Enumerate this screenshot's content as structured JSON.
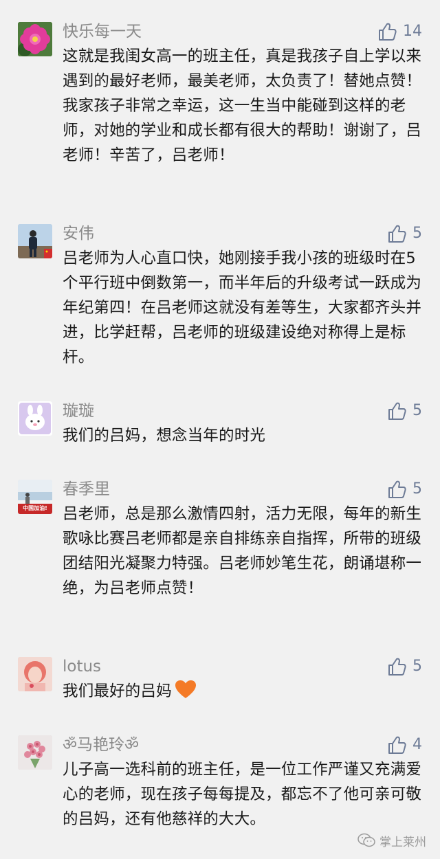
{
  "comments": [
    {
      "user": "快乐每一天",
      "likes": "14",
      "text": "这就是我闺女高一的班主任，真是我孩子自上学以来遇到的最好老师，最美老师，太负责了！替她点赞！我家孩子非常之幸运，这一生当中能碰到这样的老师，对她的学业和成长都有很大的帮助！谢谢了，吕老师！辛苦了，吕老师！"
    },
    {
      "user": "安伟",
      "likes": "5",
      "text": "吕老师为人心直口快，她刚接手我小孩的班级时在5个平行班中倒数第一，而半年后的升级考试一跃成为年纪第四！在吕老师这就没有差等生，大家都齐头并进，比学赶帮，吕老师的班级建设绝对称得上是标杆。"
    },
    {
      "user": "璇璇",
      "likes": "5",
      "text": "我们的吕妈，想念当年的时光"
    },
    {
      "user": "春季里",
      "likes": "5",
      "avatar_caption": "中国加油!",
      "text": "吕老师，总是那么激情四射，活力无限，每年的新生歌咏比赛吕老师都是亲自排练亲自指挥，所带的班级团结阳光凝聚力特强。吕老师妙笔生花，朗诵堪称一绝，为吕老师点赞！"
    },
    {
      "user": "lotus",
      "likes": "5",
      "text": "我们最好的吕妈"
    },
    {
      "user": "ॐ马艳玲ॐ",
      "likes": "4",
      "text": "儿子高一选科前的班主任，是一位工作严谨又充满爱心的老师，现在孩子每每提及，都忘不了他可亲可敬的吕妈，还有他慈祥的大大。"
    }
  ],
  "watermark": "掌上莱州",
  "colors": {
    "background": "#f1f1f1",
    "name": "#8a8a8a",
    "like": "#6d7b96",
    "text": "#1a1a1a"
  },
  "icons": {
    "like": "thumbs-up-icon",
    "heart": "orange-heart-icon",
    "watermark": "wechat-icon"
  }
}
